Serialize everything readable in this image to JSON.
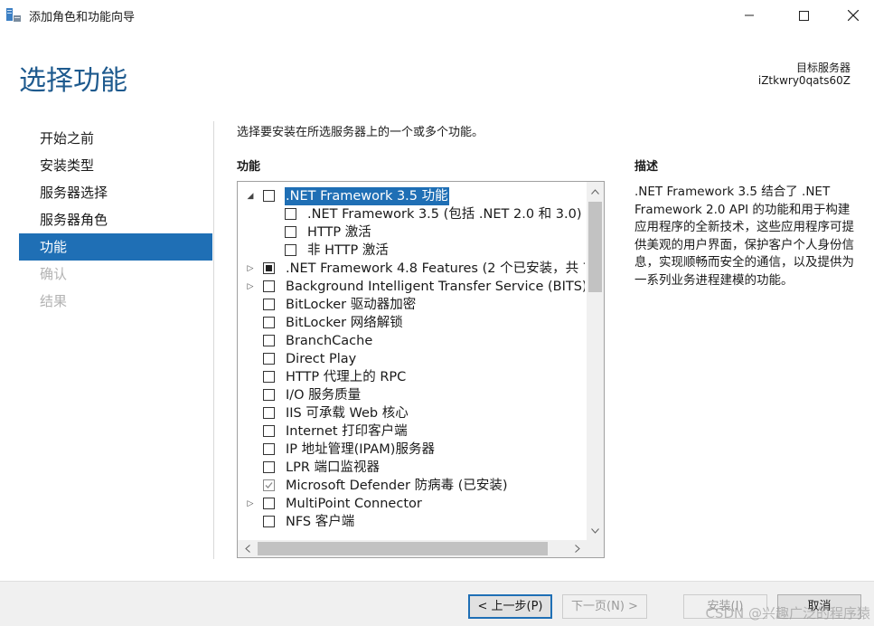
{
  "window": {
    "title": "添加角色和功能向导",
    "controls": {
      "minimize_icon": "minimize-icon",
      "maximize_icon": "maximize-icon",
      "close_icon": "close-icon"
    }
  },
  "header": {
    "page_title": "选择功能",
    "destination_label": "目标服务器",
    "destination_server": "iZtkwry0qats60Z"
  },
  "nav": {
    "items": [
      {
        "label": "开始之前",
        "state": "normal"
      },
      {
        "label": "安装类型",
        "state": "normal"
      },
      {
        "label": "服务器选择",
        "state": "normal"
      },
      {
        "label": "服务器角色",
        "state": "normal"
      },
      {
        "label": "功能",
        "state": "active"
      },
      {
        "label": "确认",
        "state": "disabled"
      },
      {
        "label": "结果",
        "state": "disabled"
      }
    ]
  },
  "content": {
    "instruction": "选择要安装在所选服务器上的一个或多个功能。",
    "features_heading": "功能",
    "features": [
      {
        "label": ".NET Framework 3.5 功能",
        "level": 0,
        "expander": "expanded",
        "check": "unchecked",
        "selected": true
      },
      {
        "label": ".NET Framework 3.5 (包括 .NET 2.0 和 3.0)",
        "level": 1,
        "expander": "none",
        "check": "unchecked",
        "selected": false
      },
      {
        "label": "HTTP 激活",
        "level": 1,
        "expander": "none",
        "check": "unchecked",
        "selected": false
      },
      {
        "label": "非 HTTP 激活",
        "level": 1,
        "expander": "none",
        "check": "unchecked",
        "selected": false
      },
      {
        "label": ".NET Framework 4.8 Features (2 个已安装，共 7",
        "level": 0,
        "expander": "collapsed",
        "check": "partial",
        "selected": false
      },
      {
        "label": "Background Intelligent Transfer Service (BITS)",
        "level": 0,
        "expander": "collapsed",
        "check": "unchecked",
        "selected": false
      },
      {
        "label": "BitLocker 驱动器加密",
        "level": 0,
        "expander": "none",
        "check": "unchecked",
        "selected": false
      },
      {
        "label": "BitLocker 网络解锁",
        "level": 0,
        "expander": "none",
        "check": "unchecked",
        "selected": false
      },
      {
        "label": "BranchCache",
        "level": 0,
        "expander": "none",
        "check": "unchecked",
        "selected": false
      },
      {
        "label": "Direct Play",
        "level": 0,
        "expander": "none",
        "check": "unchecked",
        "selected": false
      },
      {
        "label": "HTTP 代理上的 RPC",
        "level": 0,
        "expander": "none",
        "check": "unchecked",
        "selected": false
      },
      {
        "label": "I/O 服务质量",
        "level": 0,
        "expander": "none",
        "check": "unchecked",
        "selected": false
      },
      {
        "label": "IIS 可承载 Web 核心",
        "level": 0,
        "expander": "none",
        "check": "unchecked",
        "selected": false
      },
      {
        "label": "Internet 打印客户端",
        "level": 0,
        "expander": "none",
        "check": "unchecked",
        "selected": false
      },
      {
        "label": "IP 地址管理(IPAM)服务器",
        "level": 0,
        "expander": "none",
        "check": "unchecked",
        "selected": false
      },
      {
        "label": "LPR 端口监视器",
        "level": 0,
        "expander": "none",
        "check": "unchecked",
        "selected": false
      },
      {
        "label": "Microsoft Defender 防病毒 (已安装)",
        "level": 0,
        "expander": "none",
        "check": "checked-disabled",
        "selected": false
      },
      {
        "label": "MultiPoint Connector",
        "level": 0,
        "expander": "collapsed",
        "check": "unchecked",
        "selected": false
      },
      {
        "label": "NFS 客户端",
        "level": 0,
        "expander": "none",
        "check": "unchecked",
        "selected": false
      }
    ],
    "description_heading": "描述",
    "description_text": ".NET Framework 3.5 结合了 .NET Framework 2.0 API 的功能和用于构建应用程序的全新技术，这些应用程序可提供美观的用户界面，保护客户个人身份信息，实现顺畅而安全的通信，以及提供为一系列业务进程建模的功能。"
  },
  "footer": {
    "prev_label": "< 上一步(P)",
    "next_label": "下一页(N) >",
    "install_label": "安装(I)",
    "cancel_label": "取消",
    "watermark": "CSDN @兴趣广泛的程序猿"
  },
  "colors": {
    "accent": "#1f6fb5",
    "title": "#1e5a8e"
  }
}
